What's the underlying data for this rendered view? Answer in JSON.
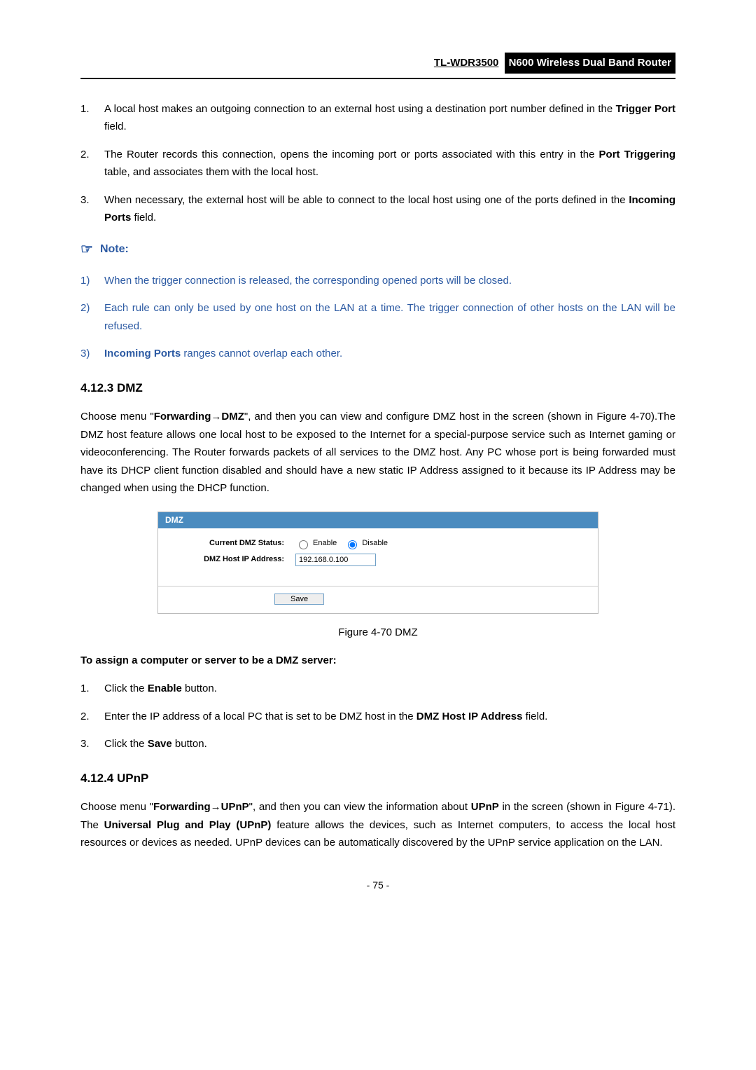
{
  "header": {
    "model": "TL-WDR3500",
    "title": "N600 Wireless Dual Band Router"
  },
  "list1": {
    "item1_num": "1.",
    "item1_a": "A local host makes an outgoing connection to an external host using a destination port number defined in the ",
    "item1_b": "Trigger Port",
    "item1_c": " field.",
    "item2_num": "2.",
    "item2_a": "The Router records this connection, opens the incoming port or ports associated with this entry in the ",
    "item2_b": "Port Triggering",
    "item2_c": " table, and associates them with the local host.",
    "item3_num": "3.",
    "item3_a": "When necessary, the external host will be able to connect to the local host using one of the ports defined in the ",
    "item3_b": "Incoming Ports",
    "item3_c": " field."
  },
  "note": {
    "icon": "☞",
    "label": "Note:",
    "n1_num": "1)",
    "n1": "When the trigger connection is released, the corresponding opened ports will be closed.",
    "n2_num": "2)",
    "n2": "Each rule can only be used by one host on the LAN at a time. The trigger connection of other hosts on the LAN will be refused.",
    "n3_num": "3)",
    "n3_a": "Incoming Ports",
    "n3_b": " ranges cannot overlap each other."
  },
  "dmz": {
    "heading": "4.12.3  DMZ",
    "para_a": "Choose menu \"",
    "para_b": "Forwarding",
    "para_arrow": "→",
    "para_c": "DMZ",
    "para_d": "\", and then you can view and configure DMZ host in the screen (shown in Figure 4-70).The DMZ host feature allows one local host to be exposed to the Internet for a special-purpose service such as Internet gaming or videoconferencing. The Router forwards packets of all services to the DMZ host. Any PC whose port is being forwarded must have its DHCP client function disabled and should have a new static IP Address assigned to it because its IP Address may be changed when using the DHCP function.",
    "panel": {
      "title": "DMZ",
      "status_label": "Current DMZ Status:",
      "enable": "Enable",
      "disable": "Disable",
      "ip_label": "DMZ Host IP Address:",
      "ip_value": "192.168.0.100",
      "save": "Save"
    },
    "caption": "Figure 4-70 DMZ",
    "assign_head": "To assign a computer or server to be a DMZ server:",
    "s1_num": "1.",
    "s1_a": "Click the ",
    "s1_b": "Enable",
    "s1_c": " button.",
    "s2_num": "2.",
    "s2_a": "Enter the IP address of a local PC that is set to be DMZ host in the ",
    "s2_b": "DMZ Host IP Address",
    "s2_c": " field.",
    "s3_num": "3.",
    "s3_a": "Click the ",
    "s3_b": "Save",
    "s3_c": " button."
  },
  "upnp": {
    "heading": "4.12.4  UPnP",
    "para_a": "Choose menu \"",
    "para_b": "Forwarding",
    "para_arrow": "→",
    "para_c": "UPnP",
    "para_d": "\", and then you can view the information about ",
    "para_e": "UPnP",
    "para_f": " in the screen (shown in Figure 4-71). The ",
    "para_g": "Universal Plug and Play (UPnP)",
    "para_h": " feature allows the devices, such as Internet computers, to access the local host resources or devices as needed. UPnP devices can be automatically discovered by the UPnP service application on the LAN."
  },
  "page_number": "- 75 -"
}
